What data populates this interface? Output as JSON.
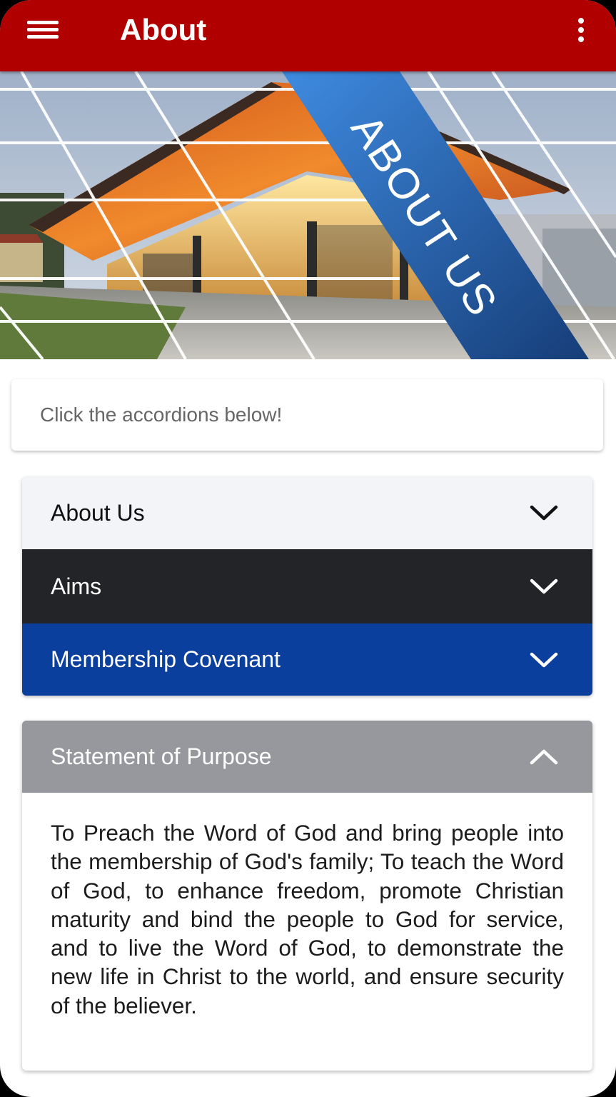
{
  "appbar": {
    "title": "About",
    "menu_icon": "hamburger-menu-icon",
    "more_icon": "more-vertical-icon",
    "color": "#b00000"
  },
  "hero": {
    "banner_text": "ABOUT US",
    "banner_color": "#1f5ea8"
  },
  "hint": {
    "text": "Click the accordions below!"
  },
  "accordions": [
    {
      "label": "About Us",
      "state": "collapsed",
      "color": "#f3f4f8"
    },
    {
      "label": "Aims",
      "state": "collapsed",
      "color": "#222428"
    },
    {
      "label": "Membership Covenant",
      "state": "collapsed",
      "color": "#0a3f9d"
    }
  ],
  "purpose": {
    "label": "Statement of Purpose",
    "state": "expanded",
    "color": "#96989e",
    "body": "To Preach the Word of God and bring people into the membership of God's family; To teach the Word of God, to enhance freedom, promote Christian maturity and bind the people to God for service, and to live the Word of God, to demonstrate the new life in Christ to the world, and ensure security of the believer."
  }
}
